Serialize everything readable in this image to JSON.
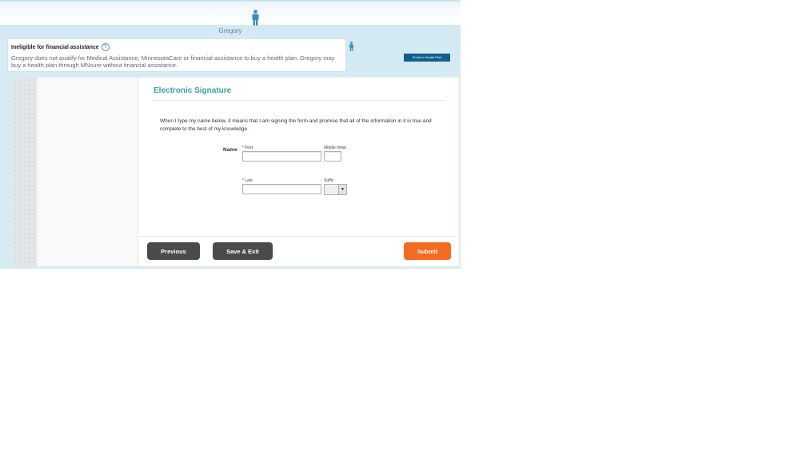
{
  "header": {
    "person_name": "Gregory"
  },
  "notice": {
    "title": "Ineligible for financial assistance",
    "help_icon": "?",
    "text": "Gregory does not qualify for Medical Assistance, MinnesotaCare or financial assistance to buy a health plan. Gregory may buy a health plan through MNsure without financial assistance."
  },
  "side": {
    "enroll_label": "Enroll in Health Plan"
  },
  "main": {
    "title": "Electronic Signature",
    "intro": "When I type my name below, it means that I am signing the form and promise that all of the information in it is true and complete to the best of my knowledge.",
    "name_label": "Name",
    "first_label": "* First",
    "middle_label": "Middle Initial",
    "last_label": "* Last",
    "suffix_label": "Suffix",
    "first_value": "",
    "middle_value": "",
    "last_value": "",
    "suffix_value": ""
  },
  "footer": {
    "previous_label": "Previous",
    "save_label": "Save & Exit",
    "submit_label": "Submit"
  },
  "colors": {
    "accent_teal": "#3aa0a6",
    "submit_orange": "#f26b21",
    "dark_button": "#4a4a4a",
    "enroll_blue": "#11608b",
    "person_icon_blue": "#3a8fb8"
  },
  "icons": {
    "person": "person-icon",
    "help": "help-icon",
    "dropdown": "chevron-down-icon"
  }
}
